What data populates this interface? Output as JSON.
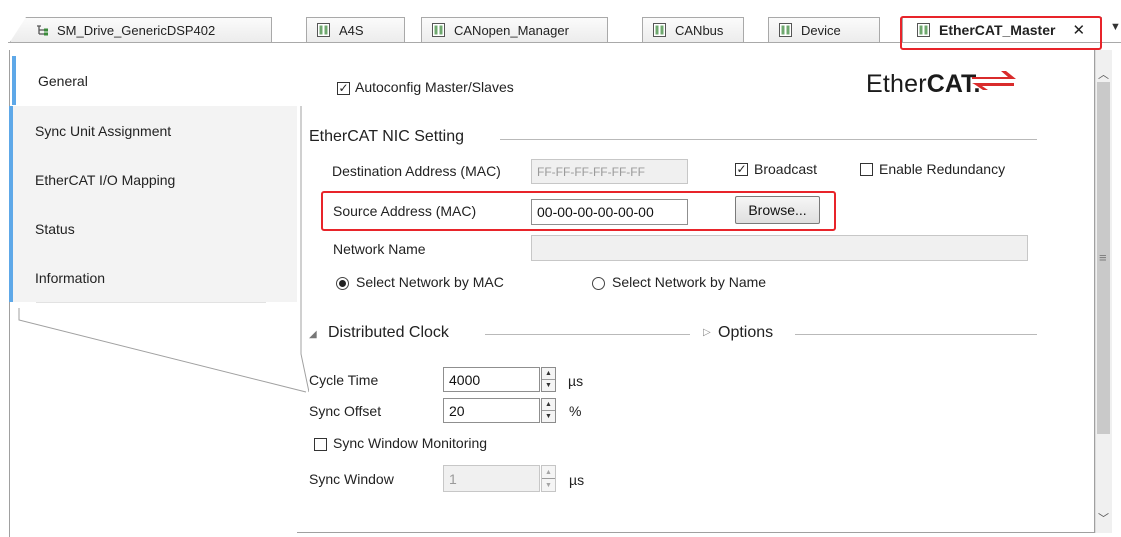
{
  "tabs": [
    {
      "label": "SM_Drive_GenericDSP402",
      "icon": "device-tree-icon",
      "active": false
    },
    {
      "label": "A4S",
      "icon": "editor-page-icon",
      "active": false
    },
    {
      "label": "CANopen_Manager",
      "icon": "editor-page-icon",
      "active": false
    },
    {
      "label": "CANbus",
      "icon": "editor-page-icon",
      "active": false
    },
    {
      "label": "Device",
      "icon": "editor-page-icon",
      "active": false
    },
    {
      "label": "EtherCAT_Master",
      "icon": "editor-page-icon",
      "active": true
    }
  ],
  "tab_close_glyph": "✕",
  "tab_overflow_glyph": "▼",
  "nav": [
    {
      "label": "General"
    },
    {
      "label": "Sync Unit Assignment"
    },
    {
      "label": "EtherCAT I/O Mapping"
    },
    {
      "label": "Status"
    },
    {
      "label": "Information"
    }
  ],
  "general": {
    "autoconfig": {
      "label": "Autoconfig Master/Slaves",
      "checked": true
    },
    "logo": {
      "text_normal": "Ether",
      "text_bold": "CAT",
      "mark": ".",
      "color": "#1b1b1b",
      "arrow_color": "#d92b2b"
    },
    "nic": {
      "title": "EtherCAT NIC Setting",
      "destination_label": "Destination Address (MAC)",
      "destination_value": "FF-FF-FF-FF-FF-FF",
      "broadcast": {
        "label": "Broadcast",
        "checked": true
      },
      "redundancy": {
        "label": "Enable Redundancy",
        "checked": false
      },
      "source_label": "Source Address (MAC)",
      "source_value": "00-00-00-00-00-00",
      "browse_label": "Browse...",
      "network_name_label": "Network Name",
      "network_name_value": "",
      "select_by_mac": {
        "label": "Select Network by MAC",
        "selected": true
      },
      "select_by_name": {
        "label": "Select Network by Name",
        "selected": false
      }
    },
    "dc": {
      "title": "Distributed Clock",
      "options_title": "Options",
      "cycle_time_label": "Cycle Time",
      "cycle_time_value": "4000",
      "cycle_time_unit": "µs",
      "sync_offset_label": "Sync Offset",
      "sync_offset_value": "20",
      "sync_offset_unit": "%",
      "sync_window_monitoring": {
        "label": "Sync Window Monitoring",
        "checked": false
      },
      "sync_window_label": "Sync Window",
      "sync_window_value": "1",
      "sync_window_unit": "µs"
    }
  },
  "colors": {
    "highlight": "#e8242a",
    "nav_accent": "#5ea8e8"
  }
}
